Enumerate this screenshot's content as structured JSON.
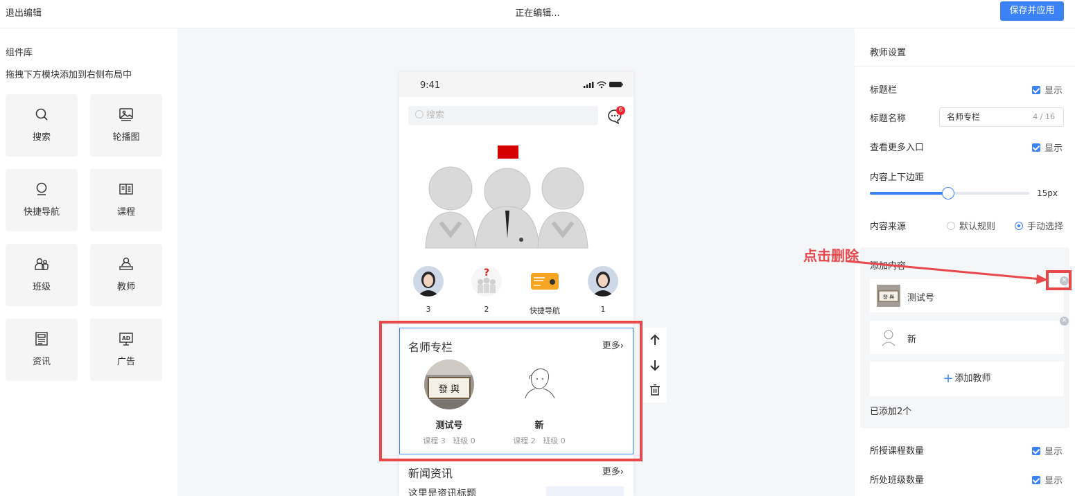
{
  "topbar": {
    "exit_label": "退出编辑",
    "status_text": "正在编辑...",
    "save_label": "保存并应用"
  },
  "library": {
    "title": "组件库",
    "hint": "拖拽下方模块添加到右侧布局中",
    "items": [
      {
        "label": "搜索",
        "icon": "search-icon"
      },
      {
        "label": "轮播图",
        "icon": "carousel-image-icon"
      },
      {
        "label": "快捷导航",
        "icon": "quick-nav-icon"
      },
      {
        "label": "课程",
        "icon": "course-book-icon"
      },
      {
        "label": "班级",
        "icon": "class-users-icon"
      },
      {
        "label": "教师",
        "icon": "teacher-icon"
      },
      {
        "label": "资讯",
        "icon": "news-icon"
      },
      {
        "label": "广告",
        "icon": "ad-icon"
      }
    ]
  },
  "phone": {
    "time": "9:41",
    "search_placeholder": "搜索",
    "message_badge": "6",
    "nav_items": [
      {
        "label": "3",
        "icon": "woman-avatar-icon"
      },
      {
        "label": "2",
        "icon": "question-people-icon"
      },
      {
        "label": "快捷导航",
        "icon": "orange-card-icon"
      },
      {
        "label": "1",
        "icon": "woman-avatar-icon"
      }
    ],
    "teacher_section": {
      "title": "名师专栏",
      "more": "更多",
      "teachers": [
        {
          "name": "测试号",
          "courses": "课程 3",
          "classes": "班级 0",
          "avatar": "calligraphy-avatar"
        },
        {
          "name": "新",
          "courses": "课程 2",
          "classes": "班级 0",
          "avatar": "sketch-avatar"
        }
      ]
    },
    "news_section": {
      "title": "新闻资讯",
      "more": "更多",
      "first_item": "这里是资讯标题"
    }
  },
  "settings": {
    "title": "教师设置",
    "title_bar": {
      "label": "标题栏",
      "option": "显示"
    },
    "title_name": {
      "label": "标题名称",
      "value": "名师专栏",
      "count": "4 / 16"
    },
    "more_entry": {
      "label": "查看更多入口",
      "option": "显示"
    },
    "padding": {
      "label": "内容上下边距",
      "value": "15px",
      "fraction": 0.49
    },
    "source": {
      "label": "内容来源",
      "options": [
        "默认规则",
        "手动选择"
      ],
      "selected": "手动选择"
    },
    "add_content": {
      "title": "添加内容",
      "teachers": [
        {
          "name": "测试号"
        },
        {
          "name": "新"
        }
      ],
      "add_button": "添加教师",
      "added_text": "已添加2个"
    },
    "course_count": {
      "label": "所授课程数量",
      "option": "显示"
    },
    "class_count": {
      "label": "所处班级数量",
      "option": "显示"
    }
  },
  "annotation": {
    "text": "点击删除"
  },
  "colors": {
    "accent": "#3b82f6",
    "annotation_red": "#e8474b",
    "badge_red": "#f5222d"
  }
}
